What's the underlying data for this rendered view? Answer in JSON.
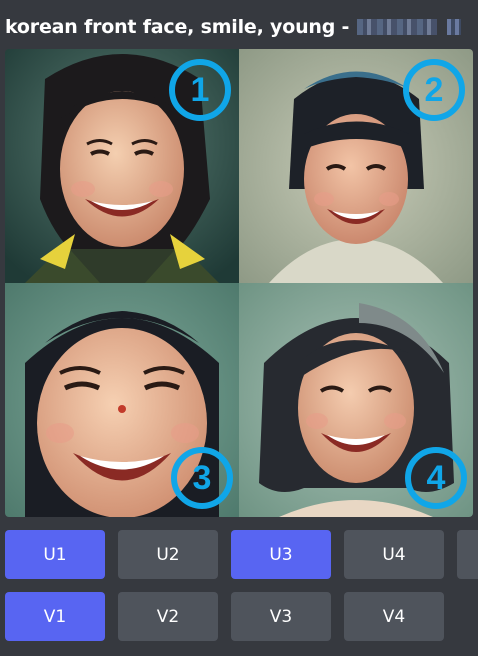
{
  "message": {
    "prompt_text": "korean front face, smile, young -"
  },
  "image_grid": {
    "badges": [
      "1",
      "2",
      "3",
      "4"
    ]
  },
  "upscale_buttons": [
    {
      "label": "U1",
      "active": true
    },
    {
      "label": "U2",
      "active": false
    },
    {
      "label": "U3",
      "active": true
    },
    {
      "label": "U4",
      "active": false
    }
  ],
  "variation_buttons": [
    {
      "label": "V1",
      "active": true
    },
    {
      "label": "V2",
      "active": false
    },
    {
      "label": "V3",
      "active": false
    },
    {
      "label": "V4",
      "active": false
    }
  ],
  "colors": {
    "background": "#36393f",
    "button": "#4f545c",
    "button_active": "#5865f2",
    "badge": "#10a6e8"
  }
}
